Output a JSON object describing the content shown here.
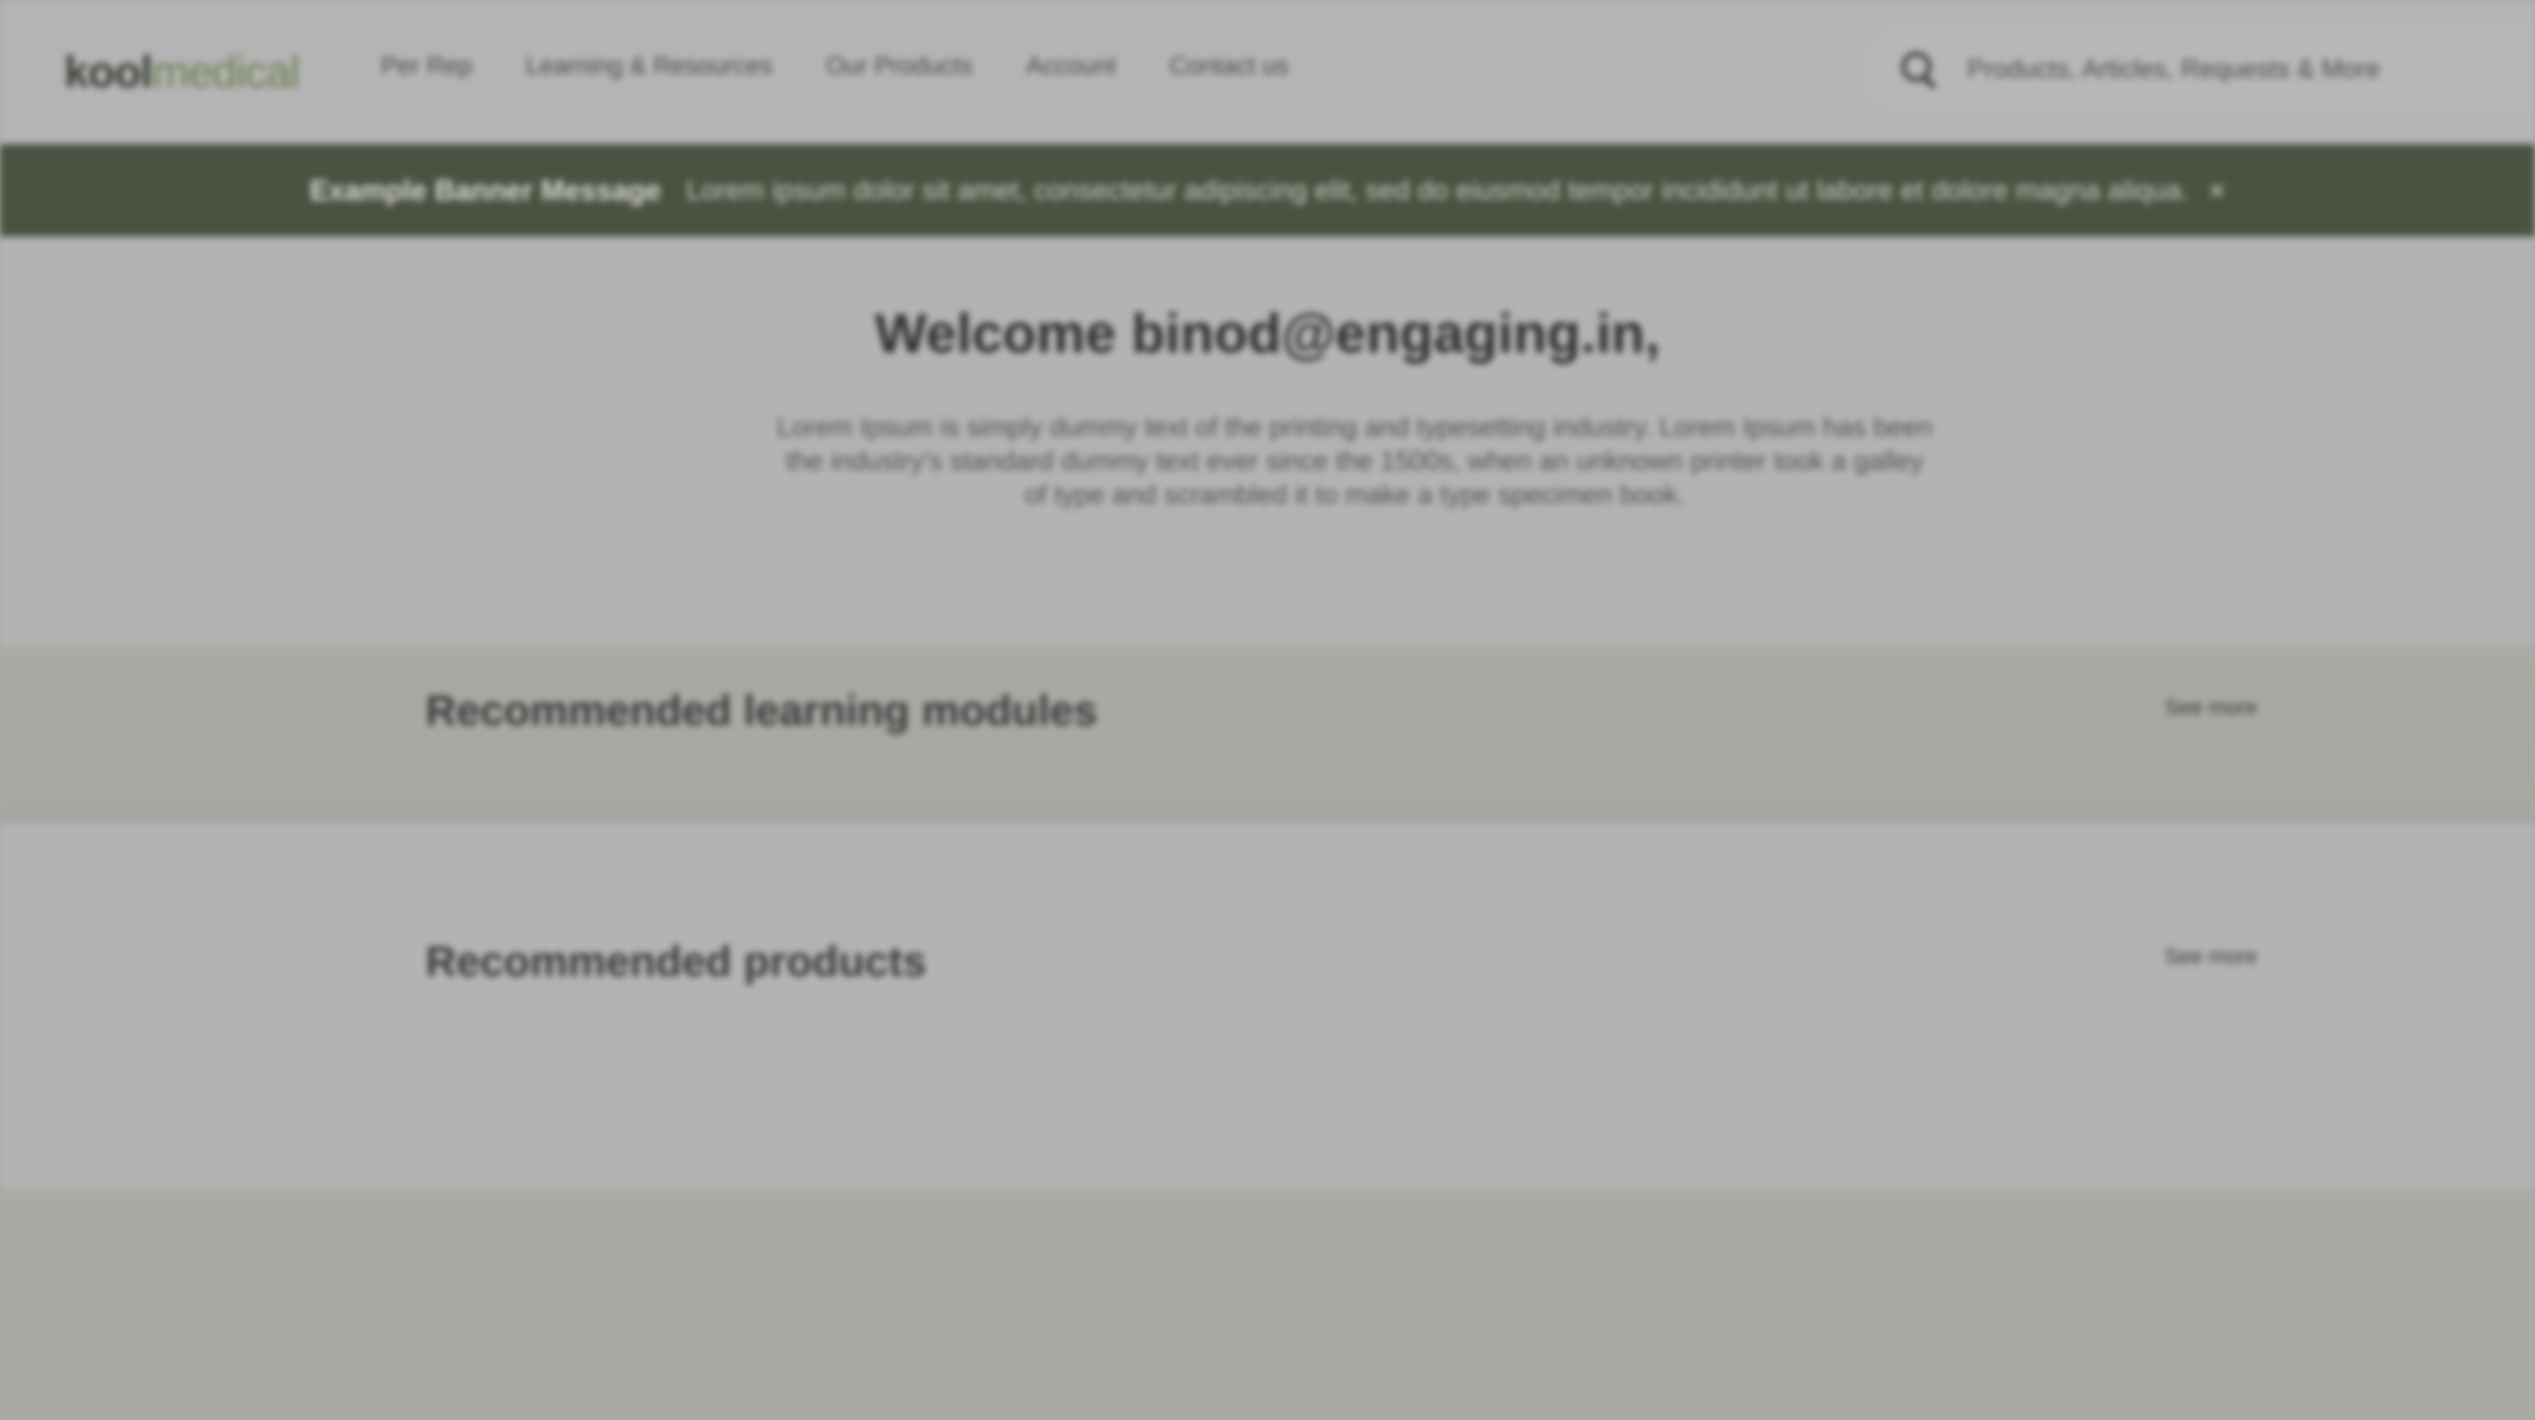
{
  "header": {
    "logo_part1": "kool",
    "logo_part2": "medical",
    "nav": [
      {
        "label": "Per Rep"
      },
      {
        "label": "Learning & Resources"
      },
      {
        "label": "Our Products"
      },
      {
        "label": "Account"
      },
      {
        "label": "Contact us"
      }
    ],
    "search": {
      "placeholder": "Products, Articles, Requests & More",
      "icon": "search-icon"
    }
  },
  "banner": {
    "title": "Example Banner Message",
    "text": "Lorem ipsum dolor sit amet, consectetur adipiscing elit, sed do eiusmod tempor incididunt ut labore et dolore magna aliqua.",
    "close_label": "×",
    "background_color": "#4b5241"
  },
  "welcome": {
    "title": "Welcome binod@engaging.in,",
    "text": "Lorem Ipsum is simply dummy text of the printing and typesetting industry. Lorem Ipsum has been the industry's standard dummy text ever since the 1500s, when an unknown printer took a galley of type and scrambled it to make a type specimen book."
  },
  "sections": [
    {
      "title": "Recommended learning modules",
      "see_more": "See more"
    },
    {
      "title": "Recommended products",
      "see_more": "See more"
    }
  ]
}
